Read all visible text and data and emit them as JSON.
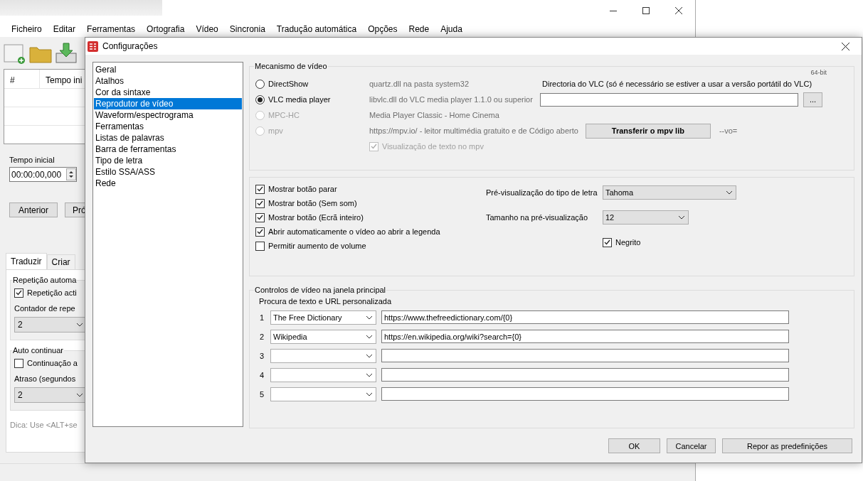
{
  "main_window": {
    "menu": [
      "Ficheiro",
      "Editar",
      "Ferramentas",
      "Ortografia",
      "Vídeo",
      "Sincronia",
      "Tradução automática",
      "Opções",
      "Rede",
      "Ajuda"
    ],
    "table": {
      "columns": [
        "#",
        "Tempo ini"
      ]
    },
    "start_time": {
      "label": "Tempo inicial",
      "value": "00:00:00,000"
    },
    "nav_buttons": [
      "Anterior",
      "Pró"
    ],
    "tabs": [
      {
        "label": "Traduzir",
        "selected": true
      },
      {
        "label": "Criar",
        "selected": false
      }
    ],
    "groups": [
      {
        "title": "Repetição automa",
        "checkbox": {
          "label": "Repetição acti",
          "checked": true
        },
        "field_label": "Contador de repe",
        "field_value": "2"
      },
      {
        "title": "Auto continuar",
        "checkbox": {
          "label": "Continuação a",
          "checked": false
        },
        "field_label": "Atraso (segundos",
        "field_value": "2"
      }
    ],
    "hint": "Dica: Use <ALT+se"
  },
  "dialog": {
    "title": "Configurações",
    "sections": [
      {
        "label": "Geral",
        "selected": false
      },
      {
        "label": "Atalhos",
        "selected": false
      },
      {
        "label": "Cor da sintaxe",
        "selected": false
      },
      {
        "label": "Reprodutor de vídeo",
        "selected": true
      },
      {
        "label": "Waveform/espectrograma",
        "selected": false
      },
      {
        "label": "Ferramentas",
        "selected": false
      },
      {
        "label": "Listas de palavras",
        "selected": false
      },
      {
        "label": "Barra de ferramentas",
        "selected": false
      },
      {
        "label": "Tipo de letra",
        "selected": false
      },
      {
        "label": "Estilo SSA/ASS",
        "selected": false
      },
      {
        "label": "Rede",
        "selected": false
      }
    ],
    "video_engine": {
      "title": "Mecanismo de vídeo",
      "bitness": "64-bit",
      "options": [
        {
          "label": "DirectShow",
          "description": "quartz.dll na pasta system32",
          "selected": false,
          "disabled": false
        },
        {
          "label": "VLC media player",
          "description": "libvlc.dll do VLC media player 1.1.0 ou superior",
          "selected": true,
          "disabled": false
        },
        {
          "label": "MPC-HC",
          "description": "Media Player Classic - Home Cinema",
          "selected": false,
          "disabled": true
        },
        {
          "label": "mpv",
          "description": "https://mpv.io/ - leitor multimédia gratuito e de Código aberto",
          "selected": false,
          "disabled": true
        }
      ],
      "vlc_folder": {
        "label": "Directoria do VLC (só é necessário se estiver a usar a versão portátil do VLC)",
        "browse_button": "..."
      },
      "download_button": "Transferir o mpv lib",
      "vo_label": "--vo=",
      "mpv_text_preview": {
        "label": "Visualização de texto no mpv",
        "checked": true,
        "disabled": true
      }
    },
    "display_options": [
      {
        "label": "Mostrar botão parar",
        "checked": true
      },
      {
        "label": "Mostrar botão (Sem som)",
        "checked": true
      },
      {
        "label": "Mostrar botão (Ecrã inteiro)",
        "checked": true
      },
      {
        "label": "Abrir automaticamente o vídeo ao abrir a legenda",
        "checked": true
      },
      {
        "label": "Permitir aumento de volume",
        "checked": false
      }
    ],
    "font_preview": {
      "label": "Pré-visualização do tipo de letra",
      "value": "Tahoma"
    },
    "preview_size": {
      "label": "Tamanho na pré-visualização",
      "value": "12"
    },
    "bold": {
      "label": "Negrito",
      "checked": true
    },
    "video_controls": {
      "title": "Controlos de vídeo na janela principal",
      "subtitle": "Procura de texto e URL personalizada",
      "rows": [
        {
          "number": "1",
          "name": "The Free Dictionary",
          "url": "https://www.thefreedictionary.com/{0}"
        },
        {
          "number": "2",
          "name": "Wikipedia",
          "url": "https://en.wikipedia.org/wiki?search={0}"
        },
        {
          "number": "3"
        },
        {
          "number": "4"
        },
        {
          "number": "5"
        }
      ]
    },
    "buttons": [
      "OK",
      "Cancelar",
      "Repor as predefinições"
    ]
  }
}
